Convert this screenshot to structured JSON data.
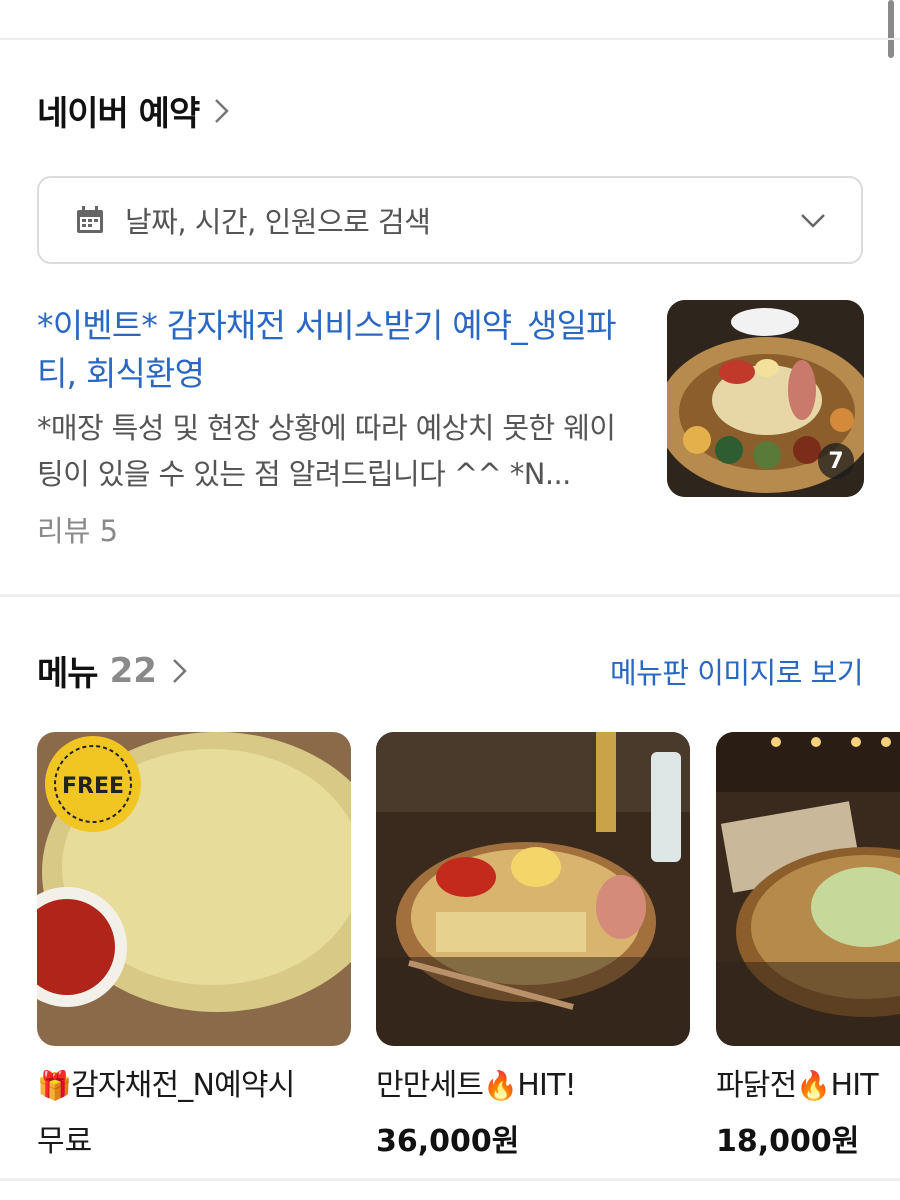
{
  "reservation": {
    "title": "네이버 예약",
    "search_placeholder": "날짜, 시간, 인원으로 검색",
    "event_title": "*이벤트* 감자채전 서비스받기 예약_생일파티, 회식환영",
    "event_desc": "*매장 특성 및 현장 상황에 따라 예상치 못한 웨이팅이 있을 수 있는 점 알려드립니다 ^^ *N...",
    "review": "리뷰 5",
    "photo_count": "7"
  },
  "menu": {
    "title": "메뉴",
    "count": "22",
    "link": "메뉴판 이미지로 보기",
    "items": [
      {
        "prefix": "🎁",
        "name": "감자채전_N예약시",
        "sub": "무료",
        "badge": "FREE"
      },
      {
        "name": "만만세트",
        "emoji": "🔥",
        "suffix": "HIT!",
        "price": "36,000원"
      },
      {
        "name": "파닭전",
        "emoji": "🔥",
        "suffix": "HIT",
        "price": "18,000원"
      }
    ]
  },
  "colors": {
    "link": "#2a68c4",
    "badge": "#f2c622"
  }
}
